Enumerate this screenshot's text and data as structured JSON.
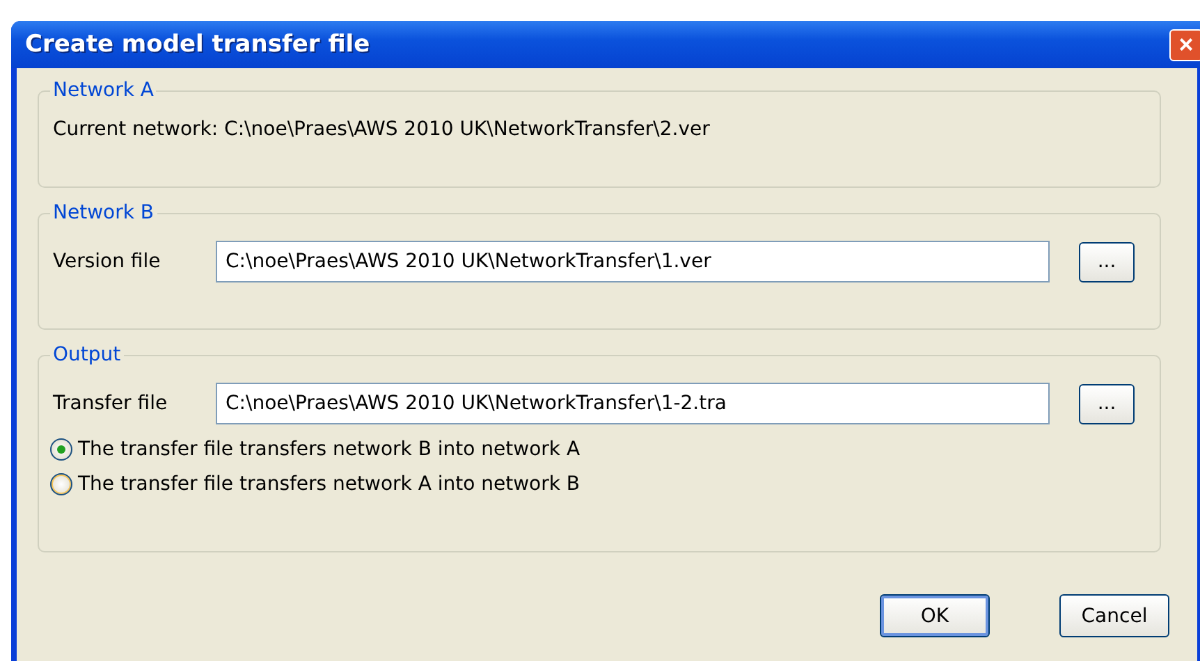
{
  "window": {
    "title": "Create model transfer file",
    "close": "×"
  },
  "network_a": {
    "legend": "Network A",
    "label": "Current network:",
    "value": "C:\\noe\\Praes\\AWS 2010 UK\\NetworkTransfer\\2.ver"
  },
  "network_b": {
    "legend": "Network B",
    "label": "Version file",
    "value": "C:\\noe\\Praes\\AWS 2010 UK\\NetworkTransfer\\1.ver",
    "browse": "..."
  },
  "output": {
    "legend": "Output",
    "label": "Transfer file",
    "value": "C:\\noe\\Praes\\AWS 2010 UK\\NetworkTransfer\\1-2.tra",
    "browse": "...",
    "options": [
      {
        "label": "The transfer file transfers network B into network A",
        "selected": true
      },
      {
        "label": "The transfer file transfers network A into network B",
        "selected": false
      }
    ]
  },
  "buttons": [
    {
      "label": "OK",
      "default": true
    },
    {
      "label": "Cancel",
      "default": false
    }
  ]
}
